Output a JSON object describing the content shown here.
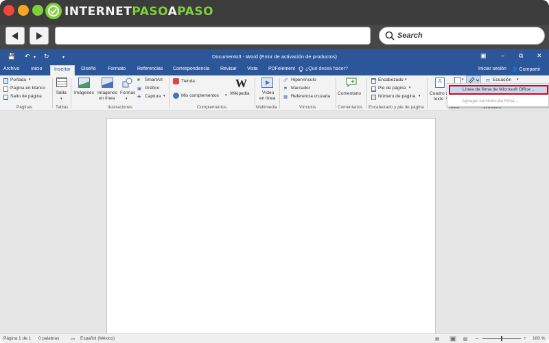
{
  "browser": {
    "brand": {
      "part1": "INTERNET",
      "part2": "PASO",
      "part3": "A",
      "part4": "PASO"
    },
    "search": {
      "label": "Search"
    },
    "url": ""
  },
  "word": {
    "title": "Documento3 - Word (Error de activación de productos)",
    "tabs": [
      "Archivo",
      "Inicio",
      "Insertar",
      "Diseño",
      "Formato",
      "Referencias",
      "Correspondencia",
      "Revisar",
      "Vista",
      "PDFelement"
    ],
    "active_tab": "Insertar",
    "tell_me": "¿Qué desea hacer?",
    "signin": "Iniciar sesión",
    "share": "Compartir",
    "ribbon": {
      "paginas": {
        "items": [
          "Portada",
          "Página en blanco",
          "Salto de página"
        ],
        "label": "Páginas"
      },
      "tablas": {
        "item": "Tabla",
        "label": "Tablas"
      },
      "ilustraciones": {
        "imagenes": "Imágenes",
        "imagenes_linea_1": "Imágenes",
        "imagenes_linea_2": "en línea",
        "formas": "Formas",
        "smartart": "SmartArt",
        "grafico": "Gráfico",
        "captura": "Captura",
        "label": "Ilustraciones"
      },
      "complementos": {
        "tienda": "Tienda",
        "mis": "Mis complementos",
        "wikipedia": "Wikipedia",
        "label": "Complementos"
      },
      "multimedia": {
        "video_1": "Vídeo",
        "video_2": "en línea",
        "label": "Multimedia"
      },
      "vinculos": {
        "items": [
          "Hipervínculo",
          "Marcador",
          "Referencia cruzada"
        ],
        "label": "Vínculos"
      },
      "comentarios": {
        "item": "Comentario",
        "label": "Comentarios"
      },
      "encabezado": {
        "items": [
          "Encabezado",
          "Pie de página",
          "Número de página"
        ],
        "label": "Encabezado y pie de página"
      },
      "texto": {
        "cuadro_1": "Cuadro d",
        "cuadro_2": "texto",
        "label": "Texto"
      },
      "simbolos": {
        "ecuacion": "Ecuación",
        "label": "Símbolos"
      }
    },
    "dropdown": {
      "items": [
        "Línea de firma de Microsoft Office...",
        "Agregar servicios de firma..."
      ]
    },
    "status": {
      "page": "Página 1 de 1",
      "words": "0 palabras",
      "language": "Español (México)",
      "zoom": "100 %"
    }
  },
  "colors": {
    "word_blue": "#2b579a",
    "highlight_red": "#d9001b",
    "brand_green": "#7fd13b"
  }
}
